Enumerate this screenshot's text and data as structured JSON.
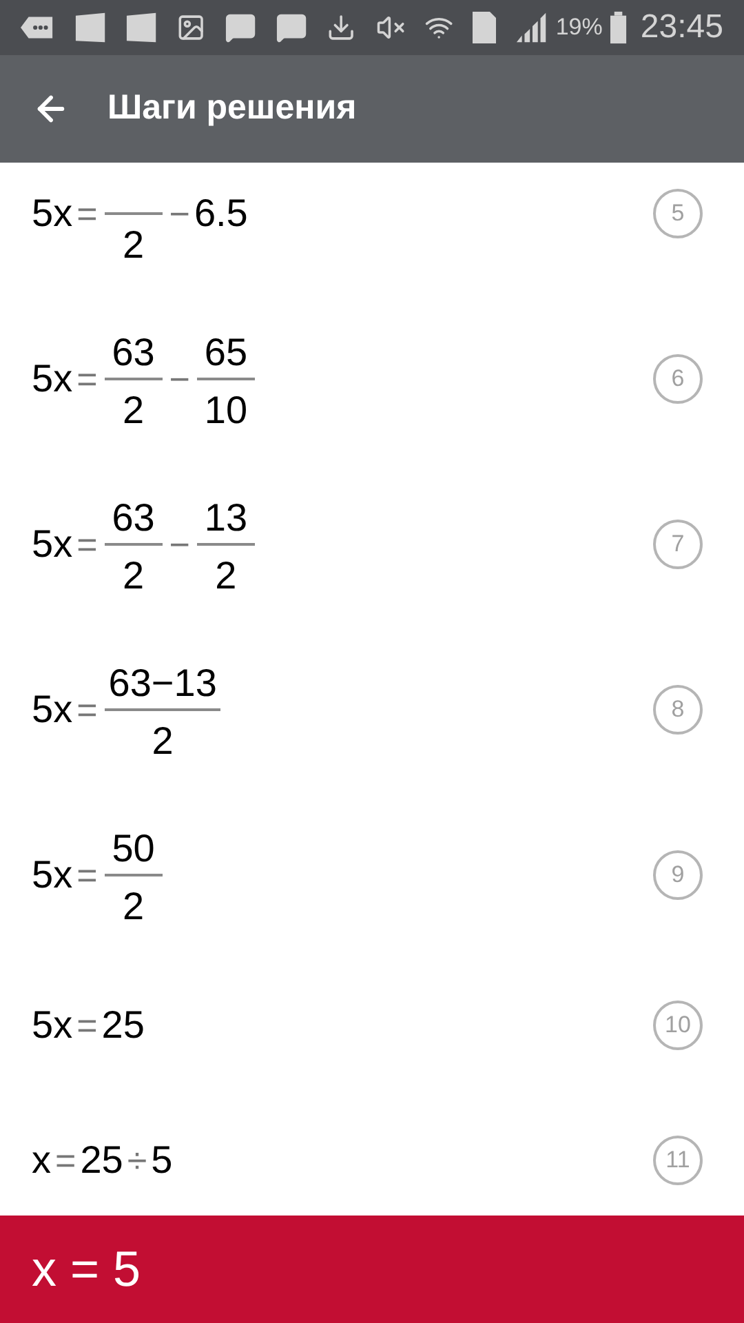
{
  "status_bar": {
    "battery": "19%",
    "time": "23:45"
  },
  "app_bar": {
    "title": "Шаги решения"
  },
  "steps": [
    {
      "number": "5",
      "terms": [
        {
          "kind": "text",
          "text": "5x"
        },
        {
          "kind": "op",
          "text": "="
        },
        {
          "kind": "frac",
          "den": "2"
        },
        {
          "kind": "op",
          "text": "−"
        },
        {
          "kind": "text",
          "text": "6.5"
        }
      ]
    },
    {
      "number": "6",
      "terms": [
        {
          "kind": "text",
          "text": "5x"
        },
        {
          "kind": "op",
          "text": "="
        },
        {
          "kind": "frac",
          "num": "63",
          "den": "2"
        },
        {
          "kind": "op",
          "text": "−"
        },
        {
          "kind": "frac",
          "num": "65",
          "den": "10"
        }
      ]
    },
    {
      "number": "7",
      "terms": [
        {
          "kind": "text",
          "text": "5x"
        },
        {
          "kind": "op",
          "text": "="
        },
        {
          "kind": "frac",
          "num": "63",
          "den": "2"
        },
        {
          "kind": "op",
          "text": "−"
        },
        {
          "kind": "frac",
          "num": "13",
          "den": "2"
        }
      ]
    },
    {
      "number": "8",
      "terms": [
        {
          "kind": "text",
          "text": "5x"
        },
        {
          "kind": "op",
          "text": "="
        },
        {
          "kind": "frac",
          "num": "63−13",
          "den": "2"
        }
      ]
    },
    {
      "number": "9",
      "terms": [
        {
          "kind": "text",
          "text": "5x"
        },
        {
          "kind": "op",
          "text": "="
        },
        {
          "kind": "frac",
          "num": "50",
          "den": "2"
        }
      ]
    },
    {
      "number": "10",
      "terms": [
        {
          "kind": "text",
          "text": "5x"
        },
        {
          "kind": "op",
          "text": "="
        },
        {
          "kind": "text",
          "text": "25"
        }
      ]
    },
    {
      "number": "11",
      "terms": [
        {
          "kind": "text",
          "text": "x"
        },
        {
          "kind": "op",
          "text": "="
        },
        {
          "kind": "text",
          "text": "25"
        },
        {
          "kind": "op",
          "text": "÷"
        },
        {
          "kind": "text",
          "text": "5"
        }
      ]
    }
  ],
  "result": {
    "text": "x = 5"
  }
}
